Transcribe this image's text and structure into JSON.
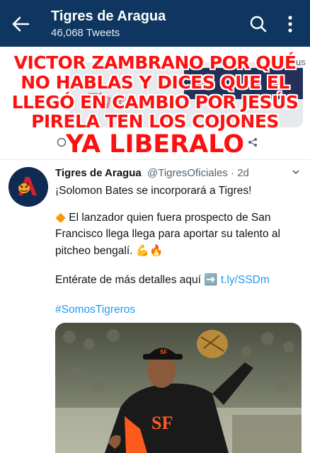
{
  "header": {
    "title": "Tigres de Aragua",
    "subtitle": "46,068 Tweets",
    "back_icon": "arrow-left-icon",
    "search_icon": "search-icon",
    "more_icon": "more-vertical-icon"
  },
  "meme_caption": {
    "line1": "VICTOR ZAMBRANO POR QUÉ",
    "line2": "NO HABLAS Y DICES QUE EL",
    "line3": "LLEGÓ EN CAMBIO POR JESÚS",
    "line4": "PIRELA TEN LOS COJONES",
    "line5": "YA LIBERALO"
  },
  "previous_tweet": {
    "partial_text": "us"
  },
  "tweet": {
    "author_name": "Tigres de Aragua",
    "author_handle": "@TigresOficiales",
    "separator": "·",
    "time": "2d",
    "line1": "¡Solomon Bates se incorporará a Tigres!",
    "line2_bullet": "🔶",
    "line2": "El lanzador quien fuera prospecto de San",
    "line3": "Francisco llega llega para aportar su talento al",
    "line4": "pitcheo bengalí.",
    "line4_emojis": "💪🔥",
    "line5": "Entérate de más detalles aquí",
    "line5_arrow": "➡️",
    "link": "t.ly/SSDm",
    "hashtag": "#SomosTigreros",
    "media_icon": "baseball-pitcher-photo"
  },
  "colors": {
    "header_bg": "#0e3660",
    "caption_red": "#ff1010",
    "link_blue": "#1d9bf0",
    "giants_orange": "#fd5a1e"
  }
}
